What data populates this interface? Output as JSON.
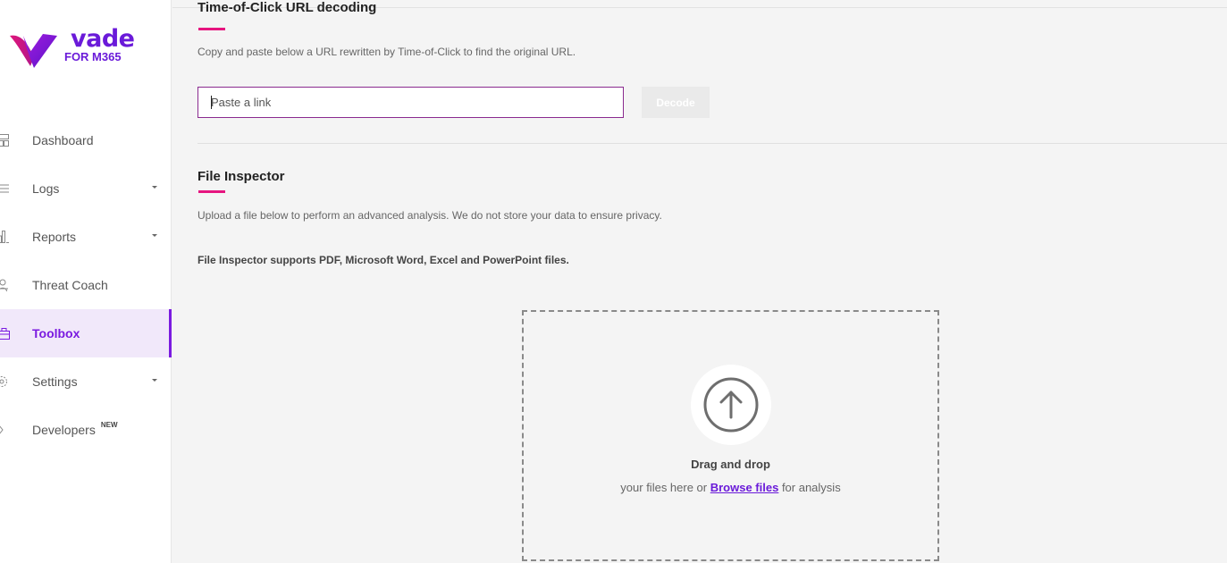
{
  "brand": {
    "name": "vade",
    "product": "FOR M365"
  },
  "sidebar": {
    "items": [
      {
        "label": "Dashboard",
        "icon": "dashboard-icon",
        "has_caret": false,
        "active": false
      },
      {
        "label": "Logs",
        "icon": "list-icon",
        "has_caret": true,
        "active": false
      },
      {
        "label": "Reports",
        "icon": "bar-chart-icon",
        "has_caret": true,
        "active": false
      },
      {
        "label": "Threat Coach",
        "icon": "user-coach-icon",
        "has_caret": false,
        "active": false
      },
      {
        "label": "Toolbox",
        "icon": "toolbox-icon",
        "has_caret": false,
        "active": true
      },
      {
        "label": "Settings",
        "icon": "gear-icon",
        "has_caret": true,
        "active": false
      },
      {
        "label": "Developers",
        "icon": "code-icon",
        "has_caret": false,
        "active": false,
        "badge": "NEW"
      }
    ]
  },
  "toc": {
    "title": "Time-of-Click URL decoding",
    "description": "Copy and paste below a URL rewritten by Time-of-Click to find the original URL.",
    "input_placeholder": "Paste a link",
    "decode_label": "Decode"
  },
  "file_inspector": {
    "title": "File Inspector",
    "description": "Upload a file below to perform an advanced analysis. We do not store your data to ensure privacy.",
    "support_note": "File Inspector supports PDF, Microsoft Word, Excel and PowerPoint files.",
    "drag_title": "Drag and drop",
    "drag_prefix": "your files here or ",
    "browse_label": "Browse files",
    "drag_suffix": " for analysis"
  },
  "colors": {
    "accent": "#7a1ae0",
    "brand_purple": "#6a1ad9",
    "underline_pink": "#e6157f"
  }
}
